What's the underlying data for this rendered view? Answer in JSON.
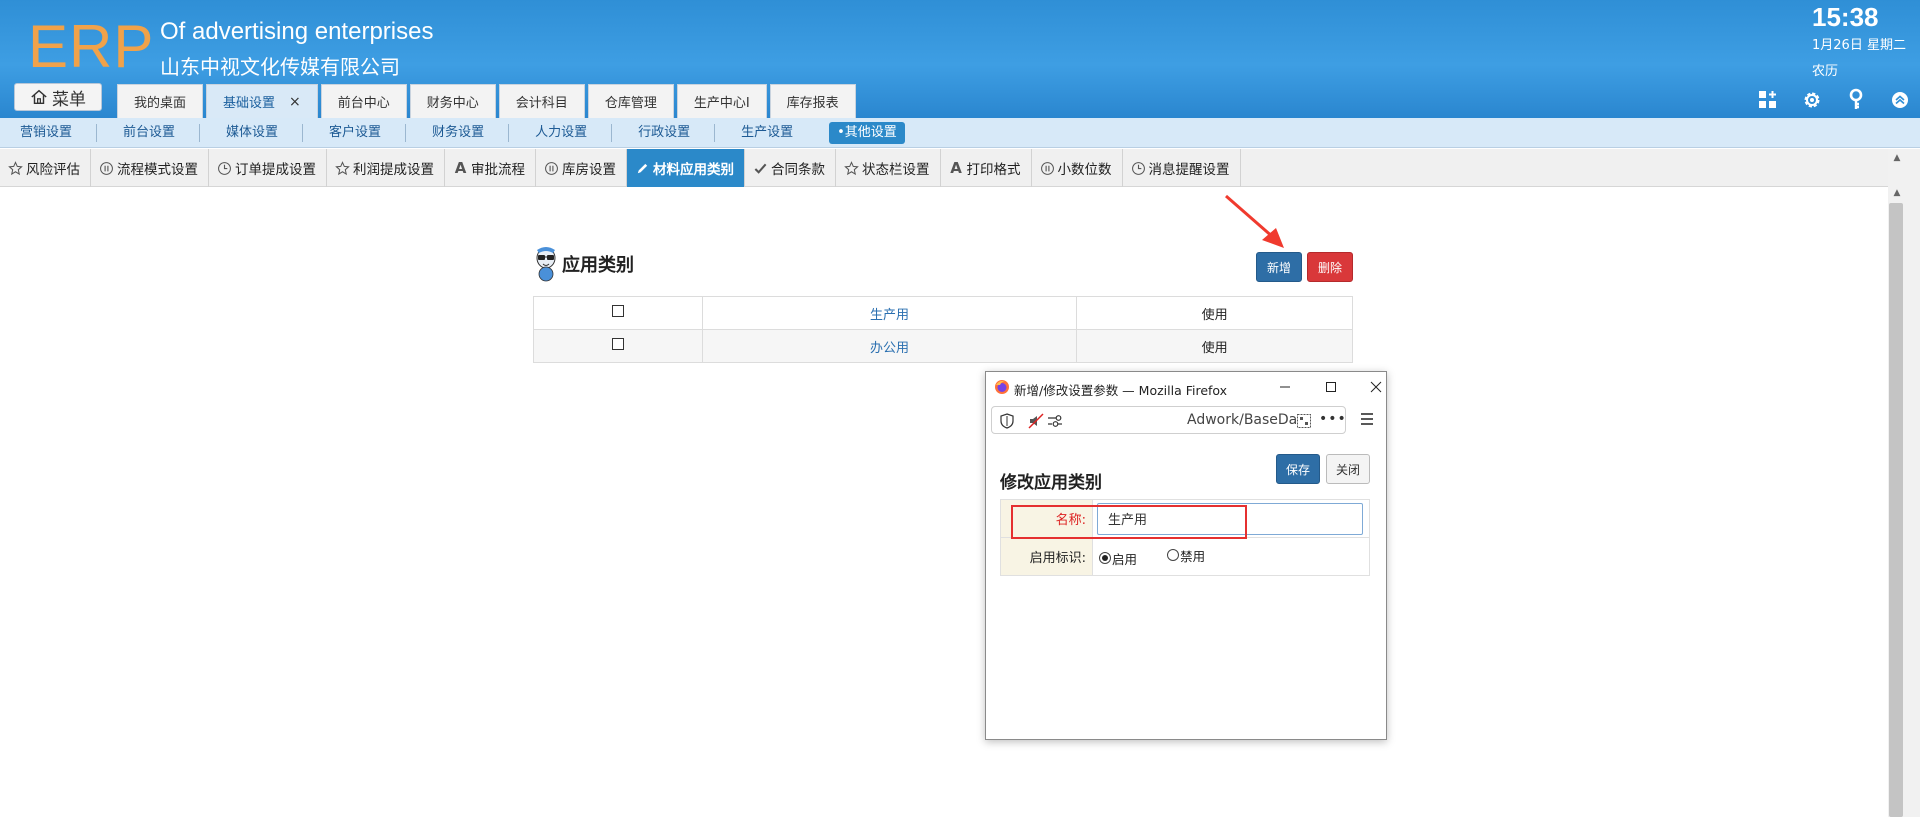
{
  "header": {
    "logo": "ERP",
    "company_en": "Of advertising enterprises",
    "company_cn": "山东中视文化传媒有限公司",
    "time": "15:38",
    "date": "1月26日 星期二",
    "lunar": "农历",
    "menu_label": "菜单"
  },
  "main_tabs": [
    {
      "label": "我的桌面"
    },
    {
      "label": "基础设置",
      "close": "×"
    },
    {
      "label": "前台中心"
    },
    {
      "label": "财务中心"
    },
    {
      "label": "会计科目"
    },
    {
      "label": "仓库管理"
    },
    {
      "label": "生产中心Ⅰ"
    },
    {
      "label": "库存报表"
    }
  ],
  "sub_nav": [
    {
      "label": "营销设置"
    },
    {
      "label": "前台设置"
    },
    {
      "label": "媒体设置"
    },
    {
      "label": "客户设置"
    },
    {
      "label": "财务设置"
    },
    {
      "label": "人力设置"
    },
    {
      "label": "行政设置"
    },
    {
      "label": "生产设置"
    },
    {
      "label": "•其他设置"
    }
  ],
  "settings_bar": [
    {
      "label": "风险评估",
      "icon": "star-icon"
    },
    {
      "label": "流程模式设置",
      "icon": "pause-circle-icon"
    },
    {
      "label": "订单提成设置",
      "icon": "clock-icon"
    },
    {
      "label": "利润提成设置",
      "icon": "star-icon"
    },
    {
      "label": "审批流程",
      "icon": "letter-a-icon"
    },
    {
      "label": "库房设置",
      "icon": "pause-circle-icon"
    },
    {
      "label": "材料应用类别",
      "icon": "pencil-icon"
    },
    {
      "label": "合同条款",
      "icon": "check-icon"
    },
    {
      "label": "状态栏设置",
      "icon": "star-icon"
    },
    {
      "label": "打印格式",
      "icon": "letter-a-icon"
    },
    {
      "label": "小数位数",
      "icon": "pause-circle-icon"
    },
    {
      "label": "消息提醒设置",
      "icon": "clock-icon"
    }
  ],
  "main": {
    "section_title": "应用类别",
    "add_label": "新增",
    "delete_label": "删除",
    "rows": [
      {
        "name": "生产用",
        "status": "使用"
      },
      {
        "name": "办公用",
        "status": "使用"
      }
    ]
  },
  "popup": {
    "window_title": "新增/修改设置参数 — Mozilla Firefox",
    "url": "Adwork/BaseDa",
    "url_more": "•••",
    "title": "修改应用类别",
    "save_label": "保存",
    "close_label": "关闭",
    "name_label": "名称:",
    "name_value": "生产用",
    "flag_label": "启用标识:",
    "enable_label": "启用",
    "disable_label": "禁用",
    "enabled": true
  },
  "colors": {
    "header_blue": "#3e9ee3",
    "logo_orange": "#f0a24a",
    "accent_blue": "#2b89c9",
    "button_blue": "#2e6ea6",
    "danger_red": "#d9383a",
    "highlight_red": "#e53030"
  }
}
